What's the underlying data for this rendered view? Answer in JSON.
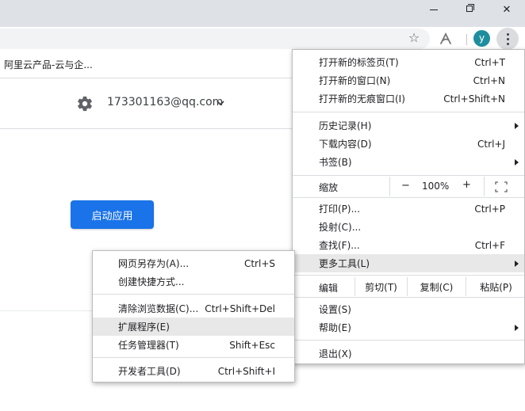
{
  "window": {
    "minimize_icon": "minimize-icon",
    "restore_icon": "restore-icon",
    "close_icon": "close-icon",
    "close_glyph": "✕"
  },
  "toolbar": {
    "bookmark_star": "☆",
    "avatar_letter": "y"
  },
  "bookmarks": {
    "item": "阿里云产品-云与企..."
  },
  "page": {
    "account_email": "173301163@qq.com",
    "launch_button": "启动应用"
  },
  "main_menu": {
    "items": [
      {
        "label": "打开新的标签页(T)",
        "shortcut": "Ctrl+T"
      },
      {
        "label": "打开新的窗口(N)",
        "shortcut": "Ctrl+N"
      },
      {
        "label": "打开新的无痕窗口(I)",
        "shortcut": "Ctrl+Shift+N"
      },
      {
        "label": "历史记录(H)",
        "shortcut": ""
      },
      {
        "label": "下载内容(D)",
        "shortcut": "Ctrl+J"
      },
      {
        "label": "书签(B)",
        "shortcut": ""
      },
      {
        "label": "打印(P)...",
        "shortcut": "Ctrl+P"
      },
      {
        "label": "投射(C)...",
        "shortcut": ""
      },
      {
        "label": "查找(F)...",
        "shortcut": "Ctrl+F"
      },
      {
        "label": "更多工具(L)",
        "shortcut": ""
      },
      {
        "label": "设置(S)",
        "shortcut": ""
      },
      {
        "label": "帮助(E)",
        "shortcut": ""
      },
      {
        "label": "退出(X)",
        "shortcut": ""
      }
    ],
    "zoom": {
      "label": "缩放",
      "minus": "−",
      "value": "100%",
      "plus": "+"
    },
    "edit": {
      "label": "编辑",
      "cut": "剪切(T)",
      "copy": "复制(C)",
      "paste": "粘贴(P)"
    }
  },
  "sub_menu": {
    "items": [
      {
        "label": "网页另存为(A)...",
        "shortcut": "Ctrl+S"
      },
      {
        "label": "创建快捷方式...",
        "shortcut": ""
      },
      {
        "label": "清除浏览数据(C)...",
        "shortcut": "Ctrl+Shift+Del"
      },
      {
        "label": "扩展程序(E)",
        "shortcut": ""
      },
      {
        "label": "任务管理器(T)",
        "shortcut": "Shift+Esc"
      },
      {
        "label": "开发者工具(D)",
        "shortcut": "Ctrl+Shift+I"
      }
    ]
  },
  "colors": {
    "titlebar": "#dee1e6",
    "accent_button": "#1a73e8",
    "avatar": "#1e8e9e",
    "hover": "#e8e8e8"
  }
}
